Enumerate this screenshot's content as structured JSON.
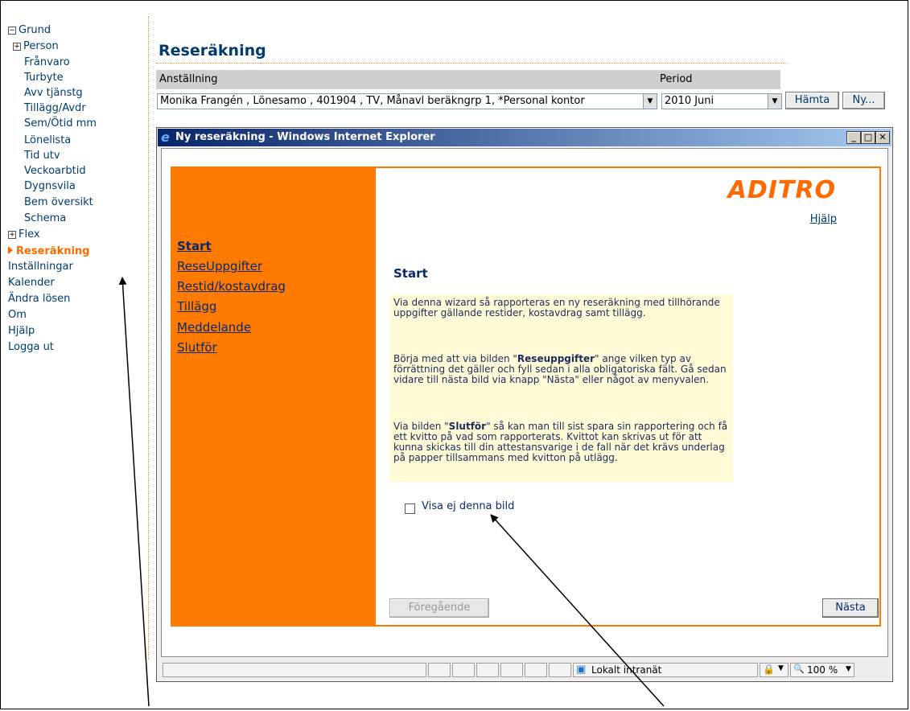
{
  "sidebar": {
    "items": [
      {
        "label": "Grund",
        "toggle": "⊟"
      },
      {
        "label": "Person",
        "toggle": "⊞"
      },
      {
        "label": "Frånvaro"
      },
      {
        "label": "Turbyte"
      },
      {
        "label": "Avv tjänstg"
      },
      {
        "label": "Tillägg/Avdr"
      },
      {
        "label": "Sem/Ötid mm"
      },
      {
        "label": "Lönelista"
      },
      {
        "label": "Tid utv"
      },
      {
        "label": "Veckoarbtid"
      },
      {
        "label": "Dygnsvila"
      },
      {
        "label": "Bem översikt"
      },
      {
        "label": "Schema"
      },
      {
        "label": "Flex",
        "toggle": "⊞"
      },
      {
        "label": "Reseräkning"
      },
      {
        "label": "Inställningar"
      },
      {
        "label": "Kalender"
      },
      {
        "label": "Ändra lösen"
      },
      {
        "label": "Om"
      },
      {
        "label": "Hjälp"
      },
      {
        "label": "Logga ut"
      }
    ]
  },
  "header": {
    "title": "Reseräkning",
    "employment_label": "Anställning",
    "period_label": "Period",
    "employment_value": "Monika Frangén , Lönesamo , 401904 , TV, Månavl beräkngrp 1, *Personal kontor",
    "period_value": "2010 Juni",
    "fetch_button": "Hämta",
    "new_button": "Ny..."
  },
  "ie_window": {
    "title": "Ny reseräkning - Windows Internet Explorer",
    "minimize": "_",
    "maximize": "□",
    "close": "✕",
    "status": {
      "zone": "Lokalt intranät",
      "zoom": "100 %",
      "zoom_icon": "🔍",
      "shield_icon": "🔒"
    }
  },
  "wizard": {
    "brand": "ADITRO",
    "help": "Hjälp",
    "nav": [
      "Start",
      "ReseUppgifter",
      "Restid/kostavdrag",
      "Tillägg",
      "Meddelande",
      "Slutför"
    ],
    "heading": "Start",
    "info": {
      "p1": "Via denna wizard så rapporteras en ny reseräkning med tillhörande uppgifter gällande restider, kostavdrag samt tillägg.",
      "p2_pre": "Börja med att via bilden \"",
      "p2_bold": "Reseuppgifter",
      "p2_post": "\" ange vilken typ av förrättning det gäller och fyll sedan i alla obligatoriska fält. Gå sedan vidare till nästa bild via knapp \"Nästa\" eller något av menyvalen.",
      "p3_pre": "Via bilden \"",
      "p3_bold": "Slutför",
      "p3_post": "\" så kan man till sist spara sin rapportering och få ett kvitto på vad som rapporterats. Kvittot kan skrivas ut för att kunna skickas till din attestansvarige i de fall när det krävs underlag på papper tillsammans med kvitton på utlägg."
    },
    "checkbox_label": "Visa ej denna bild",
    "checkbox_checked": false,
    "prev_button": "Föregående",
    "next_button": "Nästa"
  }
}
